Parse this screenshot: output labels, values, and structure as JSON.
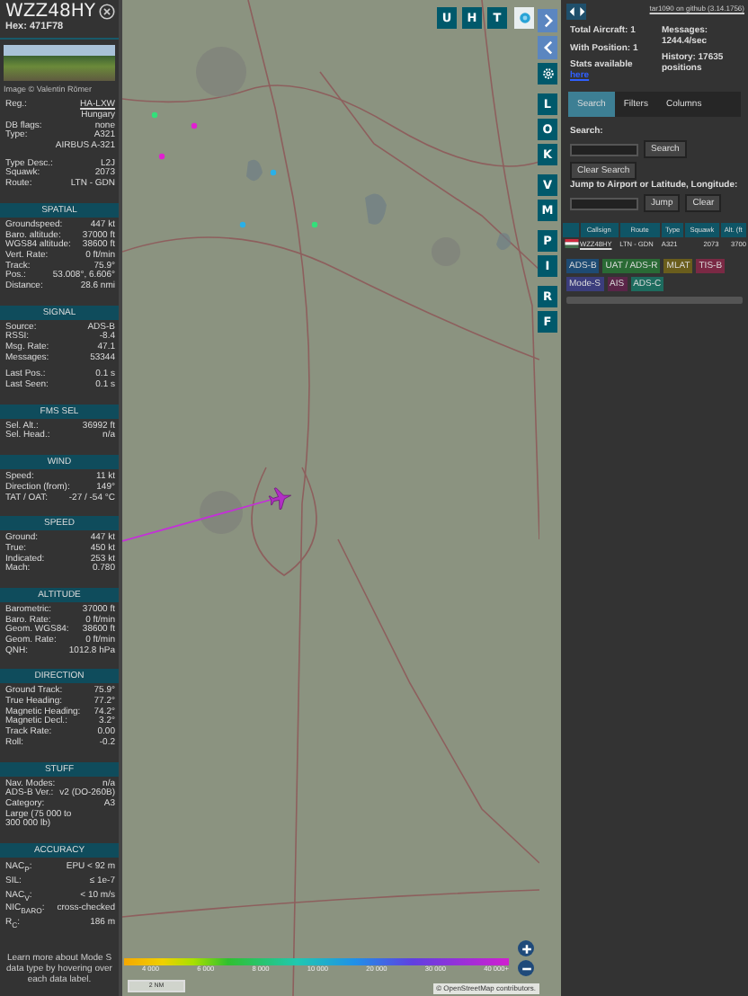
{
  "sidebar": {
    "callsign": "WZZ48HY",
    "hex": "Hex: 471F78",
    "photo_credit": "Image © Valentin Römer",
    "groups": [
      [
        {
          "kind": "link",
          "label": "Reg.:",
          "value": "HA-LXW"
        },
        {
          "kind": "pair",
          "value": "Hungary"
        },
        {
          "kind": "pair",
          "label": "DB flags:",
          "value": "none"
        },
        {
          "kind": "pair",
          "label": "Type:",
          "value": "A321"
        },
        {
          "kind": "pair",
          "value": "AIRBUS A-321"
        }
      ],
      [
        {
          "kind": "pair",
          "label": "Type Desc.:",
          "value": "L2J"
        },
        {
          "kind": "pair",
          "label": "Squawk:",
          "value": "2073"
        },
        {
          "kind": "pair",
          "label": "Route:",
          "value": "LTN - GDN"
        }
      ]
    ],
    "sections": [
      {
        "title": "SPATIAL",
        "groups": [
          [
            {
              "kind": "pair",
              "label": "Groundspeed:",
              "value": "447 kt"
            },
            {
              "kind": "pair",
              "label": "Baro. altitude:",
              "value": "37000 ft"
            },
            {
              "kind": "pair",
              "label": "WGS84 altitude:",
              "value": "38600 ft"
            },
            {
              "kind": "pair",
              "label": "Vert. Rate:",
              "value": "0 ft/min"
            },
            {
              "kind": "pair",
              "label": "Track:",
              "value": "75.9°"
            },
            {
              "kind": "pair",
              "label": "Pos.:",
              "value": "53.008°, 6.606°"
            },
            {
              "kind": "pair",
              "label": "Distance:",
              "value": "28.6 nmi"
            }
          ]
        ]
      },
      {
        "title": "SIGNAL",
        "groups": [
          [
            {
              "kind": "pair",
              "label": "Source:",
              "value": "ADS-B"
            },
            {
              "kind": "pair",
              "label": "RSSI:",
              "value": "-8.4"
            },
            {
              "kind": "pair",
              "label": "Msg. Rate:",
              "value": "47.1"
            },
            {
              "kind": "pair",
              "label": "Messages:",
              "value": "53344"
            }
          ],
          [
            {
              "kind": "pair",
              "label": "Last Pos.:",
              "value": "0.1 s"
            },
            {
              "kind": "pair",
              "label": "Last Seen:",
              "value": "0.1 s"
            }
          ]
        ]
      },
      {
        "title": "FMS SEL",
        "groups": [
          [
            {
              "kind": "pair",
              "label": "Sel. Alt.:",
              "value": "36992 ft"
            },
            {
              "kind": "pair",
              "label": "Sel. Head.:",
              "value": "n/a"
            }
          ]
        ]
      },
      {
        "title": "WIND",
        "groups": [
          [
            {
              "kind": "pair",
              "label": "Speed:",
              "value": "11 kt"
            },
            {
              "kind": "pair",
              "label": "Direction (from):",
              "value": "149°"
            },
            {
              "kind": "pair",
              "label": "TAT / OAT:",
              "value": "-27 / -54 °C"
            }
          ]
        ]
      },
      {
        "title": "SPEED",
        "groups": [
          [
            {
              "kind": "pair",
              "label": "Ground:",
              "value": "447 kt"
            },
            {
              "kind": "pair",
              "label": "True:",
              "value": "450 kt"
            },
            {
              "kind": "pair",
              "label": "Indicated:",
              "value": "253 kt"
            },
            {
              "kind": "pair",
              "label": "Mach:",
              "value": "0.780"
            }
          ]
        ]
      },
      {
        "title": "ALTITUDE",
        "groups": [
          [
            {
              "kind": "pair",
              "label": "Barometric:",
              "value": "37000 ft"
            },
            {
              "kind": "pair",
              "label": "Baro. Rate:",
              "value": "0 ft/min"
            },
            {
              "kind": "pair",
              "label": "Geom. WGS84:",
              "value": "38600 ft"
            },
            {
              "kind": "pair",
              "label": "Geom. Rate:",
              "value": "0 ft/min"
            },
            {
              "kind": "pair",
              "label": "QNH:",
              "value": "1012.8 hPa"
            }
          ]
        ]
      },
      {
        "title": "DIRECTION",
        "groups": [
          [
            {
              "kind": "pair",
              "label": "Ground Track:",
              "value": "75.9°"
            },
            {
              "kind": "pair",
              "label": "True Heading:",
              "value": "77.2°"
            },
            {
              "kind": "pair",
              "label": "Magnetic Heading:",
              "value": "74.2°"
            },
            {
              "kind": "pair",
              "label": "Magnetic Decl.:",
              "value": "3.2°"
            },
            {
              "kind": "pair",
              "label": "Track Rate:",
              "value": "0.00"
            },
            {
              "kind": "pair",
              "label": "Roll:",
              "value": "-0.2"
            }
          ]
        ]
      },
      {
        "title": "STUFF",
        "groups": [
          [
            {
              "kind": "pair",
              "label": "Nav. Modes:",
              "value": "n/a"
            },
            {
              "kind": "pair",
              "label": "ADS-B Ver.:",
              "value": "v2 (DO-260B)"
            },
            {
              "kind": "pair",
              "label": "Category:",
              "value": "A3"
            },
            {
              "kind": "wide",
              "value": "Large (75 000 to 300 000 lb)"
            }
          ]
        ]
      },
      {
        "title": "ACCURACY",
        "groups": [
          [
            {
              "kind": "tall",
              "label": "NAC$_{P}$:",
              "value": "EPU < 92 m"
            },
            {
              "kind": "tall",
              "label": "SIL:",
              "value": "≤ 1e-7"
            },
            {
              "kind": "tall",
              "label": "NAC$_{V}$:",
              "value": "< 10 m/s"
            },
            {
              "kind": "tall",
              "label": "NIC$_{BARO}$:",
              "value": "cross-checked"
            },
            {
              "kind": "tall",
              "label": "R$_{C}$:",
              "value": "186 m"
            }
          ]
        ]
      }
    ],
    "note": "Learn more about Mode S data type by hovering over each data label."
  },
  "map": {
    "top_buttons": [
      "U",
      "H",
      "T"
    ],
    "side_groups": [
      [
        "L",
        "O",
        "K"
      ],
      [
        "V",
        "M"
      ],
      [
        "P",
        "I"
      ],
      [
        "R",
        "F"
      ]
    ],
    "legend": [
      "4 000",
      "6 000",
      "8 000",
      "10 000",
      "20 000",
      "30 000",
      "40 000+"
    ],
    "scale": "2 NM",
    "attribution": "© OpenStreetMap contributors."
  },
  "panel": {
    "version_link": "tar1090 on github (3.14.1756)",
    "stats_left": [
      "Total Aircraft: 1",
      "With Position: 1"
    ],
    "stats_note": "Stats available",
    "stats_link": "here",
    "stats_right": [
      "Messages: 1244.4/sec",
      "History: 17635 positions"
    ],
    "tabs": [
      {
        "label": "Search",
        "selected": true
      },
      {
        "label": "Filters",
        "selected": false
      },
      {
        "label": "Columns",
        "selected": false
      }
    ],
    "search": {
      "label": "Search:",
      "button": "Search",
      "clear": "Clear Search"
    },
    "jump": {
      "label": "Jump to Airport or Latitude, Longitude:",
      "button": "Jump",
      "clear": "Clear"
    },
    "table": {
      "columns": [
        "Callsign",
        "Route",
        "Type",
        "Squawk",
        "Alt. (ft"
      ],
      "rows": [
        {
          "callsign": "WZZ48HY",
          "route": "LTN - GDN",
          "type": "A321",
          "squawk": "2073",
          "altitude": "3700"
        }
      ]
    },
    "sources": [
      {
        "label": "ADS-B",
        "color": "#1e4b73"
      },
      {
        "label": "UAT / ADS-R",
        "color": "#2a6a35"
      },
      {
        "label": "MLAT",
        "color": "#6a5d1c"
      },
      {
        "label": "TIS-B",
        "color": "#7a2944"
      },
      {
        "label": "Mode-S",
        "color": "#3b3d7c"
      },
      {
        "label": "AIS",
        "color": "#5a2548"
      },
      {
        "label": "ADS-C",
        "color": "#1d6b5e"
      }
    ]
  }
}
